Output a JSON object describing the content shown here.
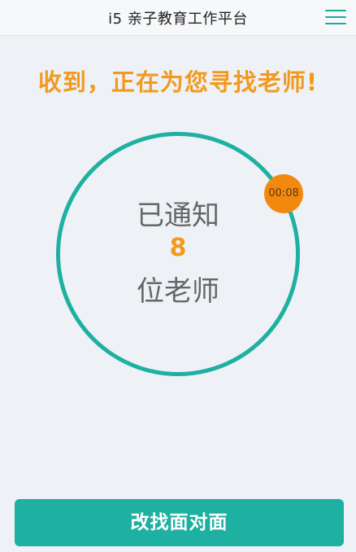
{
  "header": {
    "title": "i5 亲子教育工作平台",
    "menu_icon": "hamburger-menu-icon"
  },
  "status": {
    "message": "收到，正在为您寻找老师!",
    "notified_label": "已通知",
    "teacher_count": "8",
    "teacher_unit": "位老师",
    "timer": "00:08"
  },
  "actions": {
    "switch_label": "改找面对面"
  },
  "colors": {
    "accent_teal": "#1eb0a0",
    "accent_orange": "#f29a1f",
    "timer_orange": "#f2890e",
    "background": "#eef1f5"
  }
}
